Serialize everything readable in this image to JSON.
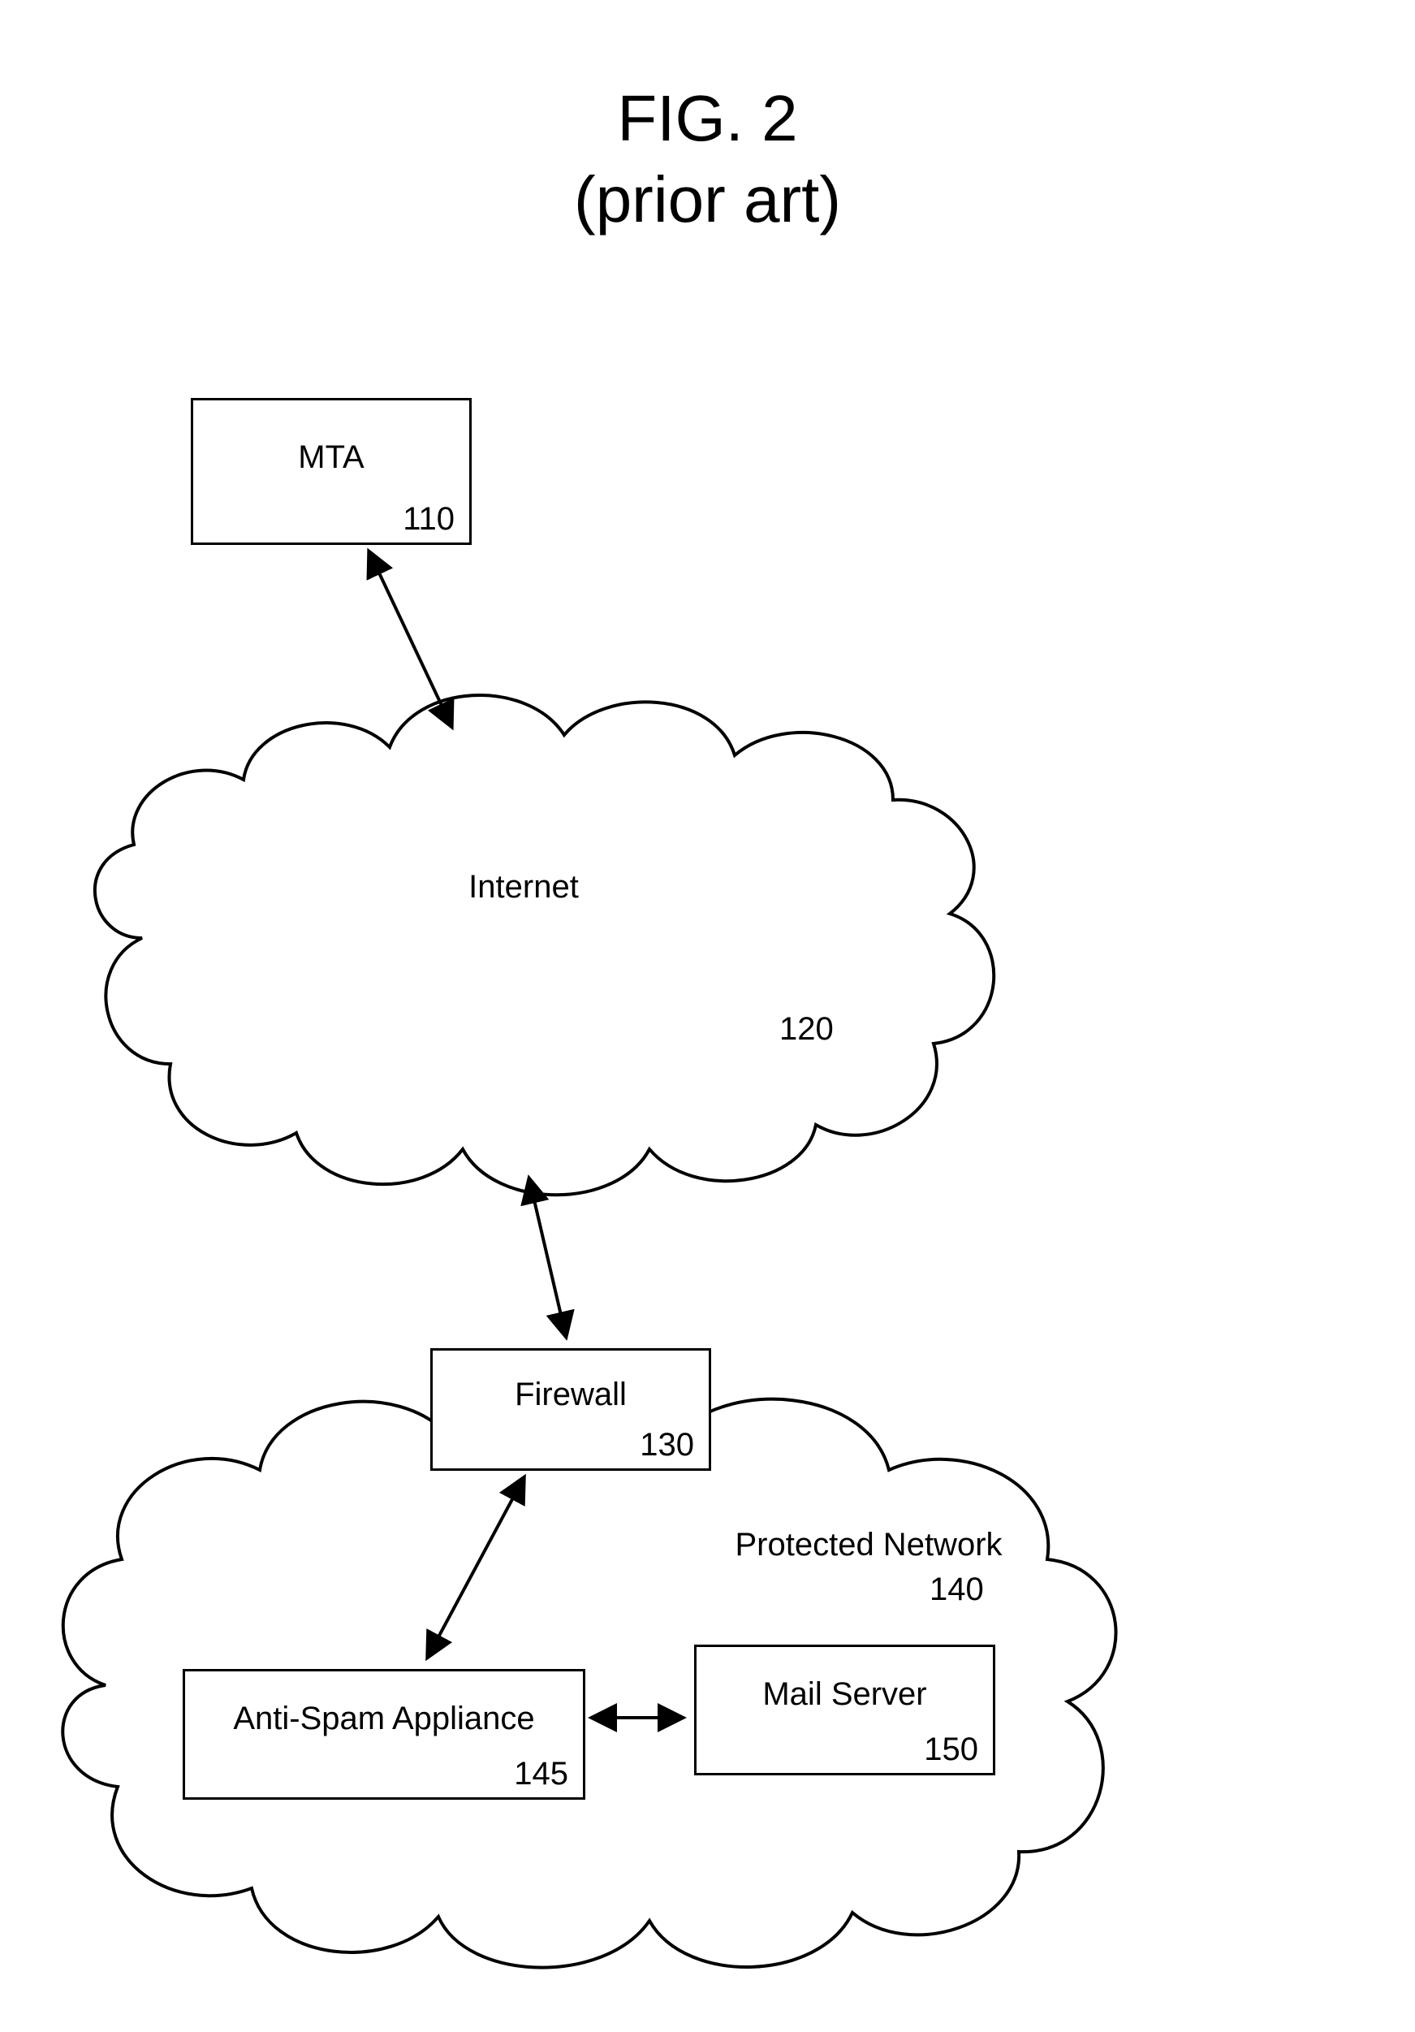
{
  "title": {
    "line1": "FIG. 2",
    "line2": "(prior art)"
  },
  "nodes": {
    "mta": {
      "label": "MTA",
      "num": "110"
    },
    "internet": {
      "label": "Internet",
      "num": "120"
    },
    "firewall": {
      "label": "Firewall",
      "num": "130"
    },
    "network": {
      "label": "Protected Network",
      "num": "140"
    },
    "antispam": {
      "label": "Anti-Spam Appliance",
      "num": "145"
    },
    "mailsrv": {
      "label": "Mail Server",
      "num": "150"
    }
  }
}
